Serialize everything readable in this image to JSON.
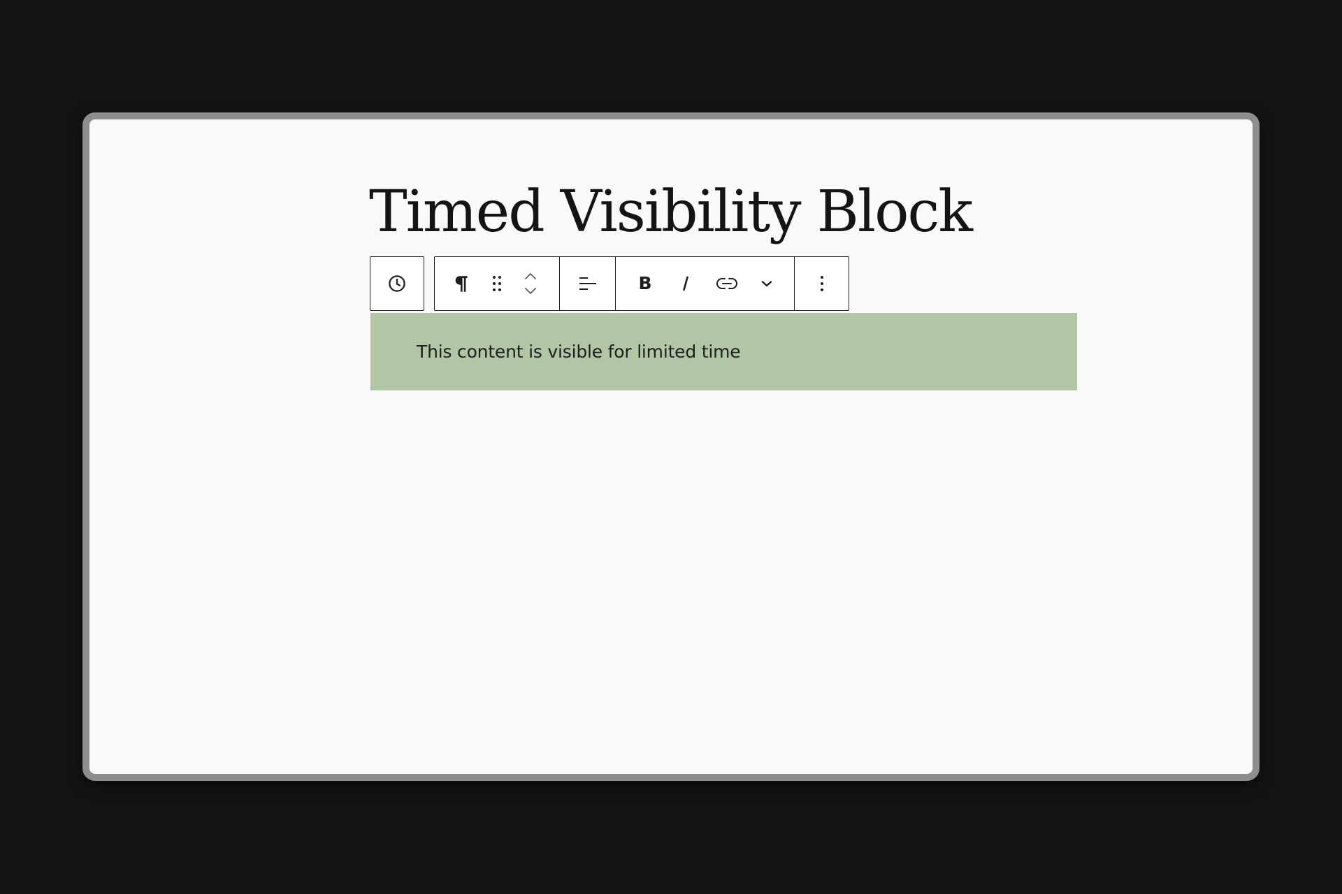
{
  "page": {
    "title": "Timed Visibility Block"
  },
  "toolbar": {
    "groups": [
      {
        "icon": "clock-icon"
      },
      {
        "icons": [
          "paragraph-icon",
          "drag-handle-icon",
          "move-up-down-icon"
        ]
      },
      {
        "icons": [
          "align-left-icon"
        ]
      },
      {
        "icons": [
          "bold-icon",
          "italic-icon",
          "link-icon",
          "chevron-down-icon"
        ]
      },
      {
        "icons": [
          "more-options-icon"
        ]
      }
    ]
  },
  "block": {
    "text": "This content is visible for limited time",
    "background_color": "#b1c6a5"
  },
  "colors": {
    "backdrop": "#141414",
    "frame": "#8d8d8d",
    "canvas": "#f9f9f9",
    "ink": "#1e1e1e"
  }
}
